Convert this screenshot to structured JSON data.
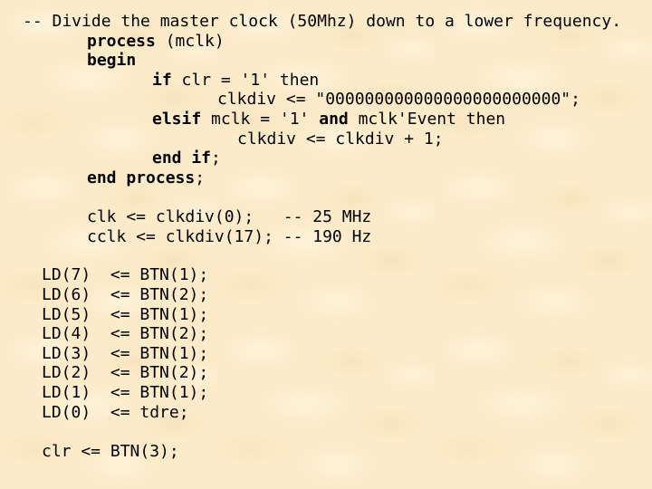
{
  "slide": {
    "background": "#fcebc9",
    "text_color": "#000000",
    "code_lines": [
      {
        "id": "comment-divide",
        "segments": [
          {
            "text": "-- Divide the master clock (50Mhz) down to a lower frequency.",
            "bold": false
          }
        ]
      },
      {
        "id": "process-header",
        "segments": [
          {
            "text": "process",
            "bold": true
          },
          {
            "text": " (mclk)",
            "bold": false
          }
        ]
      },
      {
        "id": "begin",
        "segments": [
          {
            "text": "begin",
            "bold": true
          }
        ]
      },
      {
        "id": "if-clr",
        "segments": [
          {
            "text": "if",
            "bold": true
          },
          {
            "text": " clr = '1' then",
            "bold": false
          }
        ]
      },
      {
        "id": "clkdiv-reset",
        "segments": [
          {
            "text": "clkdiv <= \"000000000000000000000000\";",
            "bold": false
          }
        ]
      },
      {
        "id": "elsif-mclk",
        "segments": [
          {
            "text": "elsif",
            "bold": true
          },
          {
            "text": " mclk = '1' ",
            "bold": false
          },
          {
            "text": "and",
            "bold": true
          },
          {
            "text": " mclk'Event then",
            "bold": false
          }
        ]
      },
      {
        "id": "clkdiv-increment",
        "segments": [
          {
            "text": "clkdiv <= clkdiv + 1;",
            "bold": false
          }
        ]
      },
      {
        "id": "end-if",
        "segments": [
          {
            "text": "end if",
            "bold": true
          },
          {
            "text": ";",
            "bold": false
          }
        ]
      },
      {
        "id": "end-process",
        "segments": [
          {
            "text": "end process",
            "bold": true
          },
          {
            "text": ";",
            "bold": false
          }
        ]
      },
      {
        "id": "clk-assign",
        "segments": [
          {
            "text": "clk <= clkdiv(0);   -- 25 MHz",
            "bold": false
          }
        ]
      },
      {
        "id": "cclk-assign",
        "segments": [
          {
            "text": "cclk <= clkdiv(17); -- 190 Hz",
            "bold": false
          }
        ]
      },
      {
        "id": "ld7-assign",
        "segments": [
          {
            "text": "LD(7)  <= BTN(1);",
            "bold": false
          }
        ]
      },
      {
        "id": "ld6-assign",
        "segments": [
          {
            "text": "LD(6)  <= BTN(2);",
            "bold": false
          }
        ]
      },
      {
        "id": "ld5-assign",
        "segments": [
          {
            "text": "LD(5)  <= BTN(1);",
            "bold": false
          }
        ]
      },
      {
        "id": "ld4-assign",
        "segments": [
          {
            "text": "LD(4)  <= BTN(2);",
            "bold": false
          }
        ]
      },
      {
        "id": "ld3-assign",
        "segments": [
          {
            "text": "LD(3)  <= BTN(1);",
            "bold": false
          }
        ]
      },
      {
        "id": "ld2-assign",
        "segments": [
          {
            "text": "LD(2)  <= BTN(2);",
            "bold": false
          }
        ]
      },
      {
        "id": "ld1-assign",
        "segments": [
          {
            "text": "LD(1)  <= BTN(1);",
            "bold": false
          }
        ]
      },
      {
        "id": "ld0-assign",
        "segments": [
          {
            "text": "LD(0)  <= tdre;",
            "bold": false
          }
        ]
      },
      {
        "id": "clr-assign",
        "segments": [
          {
            "text": "clr <= BTN(3);",
            "bold": false
          }
        ]
      }
    ]
  }
}
